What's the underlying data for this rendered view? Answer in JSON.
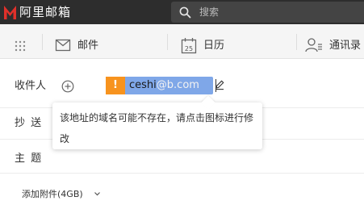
{
  "app": {
    "brand": "阿里邮箱",
    "brand_color": "#e0302a"
  },
  "search": {
    "placeholder": "搜索"
  },
  "nav": {
    "items": [
      {
        "label": "邮件",
        "icon": "mail-icon"
      },
      {
        "label": "日历",
        "icon": "calendar-icon",
        "icon_text": "25"
      },
      {
        "label": "通讯录",
        "icon": "contacts-icon"
      }
    ]
  },
  "compose": {
    "to_label": "收件人",
    "cc_label": "抄  送",
    "subject_label": "主  题",
    "recipient": {
      "warning_symbol": "!",
      "address_local": "ceshi",
      "address_domain": "@b.com"
    },
    "tooltip": "该地址的域名可能不存在，请点击图标进行修改",
    "attach_label": "添加附件(4GB)"
  },
  "colors": {
    "topbar": "#2d2d2d",
    "warning": "#f7931e",
    "recipient_bg": "#7fa7e8"
  }
}
